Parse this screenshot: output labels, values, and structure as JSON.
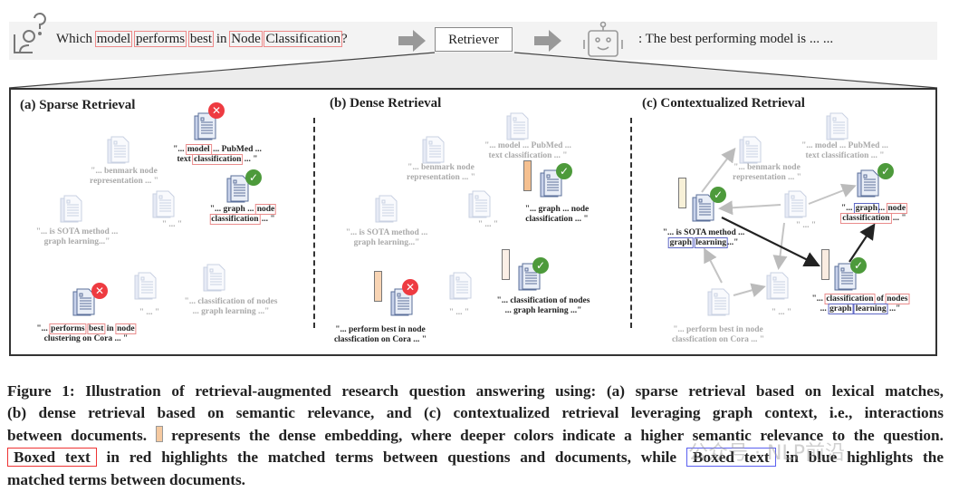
{
  "header": {
    "question": [
      {
        "t": "Which "
      },
      {
        "t": "model",
        "box": "red"
      },
      {
        "t": " "
      },
      {
        "t": "performs",
        "box": "red"
      },
      {
        "t": " "
      },
      {
        "t": "best",
        "box": "red"
      },
      {
        "t": " in "
      },
      {
        "t": "Node",
        "box": "red"
      },
      {
        "t": " "
      },
      {
        "t": "Classification",
        "box": "red"
      },
      {
        "t": "?"
      }
    ],
    "retriever": "Retriever",
    "answer": ":  The best performing model is ... ..."
  },
  "panels": [
    {
      "title": "(a) Sparse Retrieval",
      "docs": [
        {
          "status": "incorrect",
          "strong": true,
          "lines": [
            [
              {
                "t": "\"... "
              },
              {
                "t": "model",
                "box": "red"
              },
              {
                "t": " ... PubMed ..."
              }
            ],
            [
              {
                "t": "text "
              },
              {
                "t": "classification",
                "box": "red"
              },
              {
                "t": " ... \""
              }
            ]
          ]
        },
        {
          "strong": false,
          "lines": [
            [
              {
                "t": "\"... benmark node"
              }
            ],
            [
              {
                "t": "representation ... \""
              }
            ]
          ]
        },
        {
          "status": "correct",
          "strong": true,
          "lines": [
            [
              {
                "t": "\"... graph ... "
              },
              {
                "t": "node",
                "box": "red"
              }
            ],
            [
              {
                "t": "classification",
                "box": "red"
              },
              {
                "t": " ... \""
              }
            ]
          ]
        },
        {
          "strong": false,
          "lines": [
            [
              {
                "t": "\"...  is SOTA method ..."
              }
            ],
            [
              {
                "t": "graph learning...\""
              }
            ]
          ]
        },
        {
          "strong": false,
          "lines": [
            [
              {
                "t": "\" ... \""
              }
            ]
          ]
        },
        {
          "strong": false,
          "lines": [
            [
              {
                "t": "\" ... \""
              }
            ]
          ]
        },
        {
          "strong": false,
          "lines": [
            [
              {
                "t": "\"... classification of nodes"
              }
            ],
            [
              {
                "t": "... graph learning ...\""
              }
            ]
          ]
        },
        {
          "status": "incorrect",
          "strong": true,
          "lines": [
            [
              {
                "t": "\"... "
              },
              {
                "t": "performs",
                "box": "red"
              },
              {
                "t": " "
              },
              {
                "t": "best",
                "box": "red"
              },
              {
                "t": " in "
              },
              {
                "t": "node",
                "box": "red"
              }
            ],
            [
              {
                "t": "clustering on Cora  ... \""
              }
            ]
          ]
        }
      ]
    },
    {
      "title": "(b) Dense Retrieval",
      "docs": [
        {
          "strong": false,
          "lines": [
            [
              {
                "t": "\"... model ... PubMed ..."
              }
            ],
            [
              {
                "t": "text classification  ... \""
              }
            ]
          ]
        },
        {
          "strong": false,
          "lines": [
            [
              {
                "t": "\"... benmark node"
              }
            ],
            [
              {
                "t": "representation ... \""
              }
            ]
          ]
        },
        {
          "status": "correct",
          "strong": true,
          "embedding": "#f5c090",
          "lines": [
            [
              {
                "t": "\"... graph ... node"
              }
            ],
            [
              {
                "t": "classification ... \""
              }
            ]
          ]
        },
        {
          "strong": false,
          "lines": [
            [
              {
                "t": "\"...  is SOTA method ..."
              }
            ],
            [
              {
                "t": "graph learning...\""
              }
            ]
          ]
        },
        {
          "strong": false,
          "lines": [
            [
              {
                "t": "\" ... \""
              }
            ]
          ]
        },
        {
          "status": "correct",
          "strong": true,
          "embedding": "#fbefe6",
          "lines": [
            [
              {
                "t": "\"... classification of nodes"
              }
            ],
            [
              {
                "t": "... graph learning ...\""
              }
            ]
          ]
        },
        {
          "status": "incorrect",
          "strong": true,
          "embedding": "#f8d4b4",
          "lines": [
            [
              {
                "t": "\"... perform best in node"
              }
            ],
            [
              {
                "t": "classfication on Cora  ... \""
              }
            ]
          ]
        },
        {
          "strong": false,
          "lines": [
            [
              {
                "t": "\" ... \""
              }
            ]
          ]
        }
      ]
    },
    {
      "title": "(c) Contextualized Retrieval",
      "docs": [
        {
          "strong": false,
          "lines": [
            [
              {
                "t": "\"... model ... PubMed ..."
              }
            ],
            [
              {
                "t": "text classification  ... \""
              }
            ]
          ]
        },
        {
          "strong": false,
          "lines": [
            [
              {
                "t": "\"... benmark node"
              }
            ],
            [
              {
                "t": "representation ... \""
              }
            ]
          ]
        },
        {
          "status": "correct",
          "strong": true,
          "embedding": "#f8f1d8",
          "lines": [
            [
              {
                "t": "\"...  is SOTA method ..."
              }
            ],
            [
              {
                "t": "graph",
                "box": "blue"
              },
              {
                "t": " "
              },
              {
                "t": "learning",
                "box": "blue"
              },
              {
                "t": "...\""
              }
            ]
          ]
        },
        {
          "strong": false,
          "lines": [
            [
              {
                "t": "\" ... \""
              }
            ]
          ]
        },
        {
          "status": "correct",
          "strong": true,
          "lines": [
            [
              {
                "t": "\"... "
              },
              {
                "t": "graph",
                "box": "blue"
              },
              {
                "t": "... "
              },
              {
                "t": "node",
                "box": "red"
              }
            ],
            [
              {
                "t": "classification",
                "box": "red"
              },
              {
                "t": " ... \""
              }
            ]
          ]
        },
        {
          "status": "correct",
          "strong": true,
          "embedding": "#faece1",
          "lines": [
            [
              {
                "t": "\"... "
              },
              {
                "t": "classification",
                "box": "red"
              },
              {
                "t": " of "
              },
              {
                "t": "nodes",
                "box": "red"
              }
            ],
            [
              {
                "t": "... "
              },
              {
                "t": "graph",
                "box": "blue"
              },
              {
                "t": " "
              },
              {
                "t": "learning",
                "box": "blue"
              },
              {
                "t": " ...\""
              }
            ]
          ]
        },
        {
          "strong": false,
          "lines": [
            [
              {
                "t": "\" ... \""
              }
            ]
          ]
        },
        {
          "strong": false,
          "lines": [
            [
              {
                "t": "\"... perform best in node"
              }
            ],
            [
              {
                "t": "classfication on Cora  ... \""
              }
            ]
          ]
        }
      ]
    }
  ],
  "caption": {
    "line1": "Figure 1: Illustration of retrieval-augmented research question answering using: (a) sparse retrieval based on lexical matches,",
    "line2": "(b) dense retrieval based on semantic relevance, and (c) contextualized retrieval leveraging graph context, i.e., interactions",
    "line3a": "between documents.",
    "line3b": "represents the dense embedding, where deeper colors indicate a higher semantic relevance to the question.",
    "box_red": "Boxed text",
    "line4a": "in red highlights the matched terms between questions and documents, while",
    "box_blue": "Boxed text",
    "line4b": "in blue highlights the",
    "line5": "matched terms between documents."
  },
  "watermark": "公众号 · NLP前沿",
  "colors": {
    "red_box": "#e88888",
    "blue_box": "#5d66c4",
    "correct": "#4d9a3b",
    "incorrect": "#ee3b41"
  }
}
